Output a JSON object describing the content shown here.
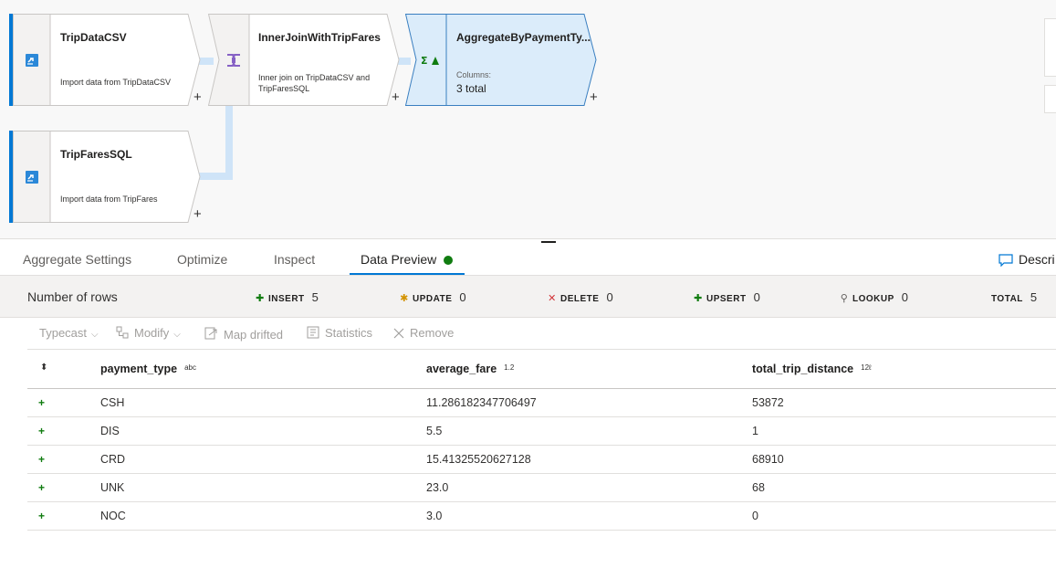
{
  "canvas": {
    "nodes": {
      "tripdata": {
        "title": "TripDataCSV",
        "desc": "Import data from TripDataCSV"
      },
      "innerjoin": {
        "title": "InnerJoinWithTripFares",
        "desc": "Inner join on TripDataCSV and TripFaresSQL"
      },
      "aggregate": {
        "title": "AggregateByPaymentTy...",
        "columns_label": "Columns:",
        "columns_value": "3 total"
      },
      "tripfares": {
        "title": "TripFaresSQL",
        "desc": "Import data from TripFares"
      }
    },
    "add_symbol": "+"
  },
  "tabs": {
    "items": [
      "Aggregate Settings",
      "Optimize",
      "Inspect",
      "Data Preview"
    ],
    "active": "Data Preview",
    "right_label": "Descri"
  },
  "stats": {
    "rows_label": "Number of rows",
    "insert": {
      "label": "INSERT",
      "value": "5"
    },
    "update": {
      "label": "UPDATE",
      "value": "0"
    },
    "delete": {
      "label": "DELETE",
      "value": "0"
    },
    "upsert": {
      "label": "UPSERT",
      "value": "0"
    },
    "lookup": {
      "label": "LOOKUP",
      "value": "0"
    },
    "total": {
      "label": "TOTAL",
      "value": "5"
    }
  },
  "toolbar": {
    "typecast": "Typecast",
    "modify": "Modify",
    "map_drifted": "Map drifted",
    "statistics": "Statistics",
    "remove": "Remove"
  },
  "table": {
    "columns": [
      {
        "name": "payment_type",
        "type": "abc"
      },
      {
        "name": "average_fare",
        "type": "1.2"
      },
      {
        "name": "total_trip_distance",
        "type": "12ℓ"
      }
    ],
    "rows": [
      [
        "CSH",
        "11.286182347706497",
        "53872"
      ],
      [
        "DIS",
        "5.5",
        "1"
      ],
      [
        "CRD",
        "15.41325520627128",
        "68910"
      ],
      [
        "UNK",
        "23.0",
        "68"
      ],
      [
        "NOC",
        "3.0",
        "0"
      ]
    ]
  },
  "colors": {
    "accent": "#0078d4",
    "success": "#107c10",
    "connector": "#cfe4f8",
    "selected_node": "#dbecfa"
  }
}
